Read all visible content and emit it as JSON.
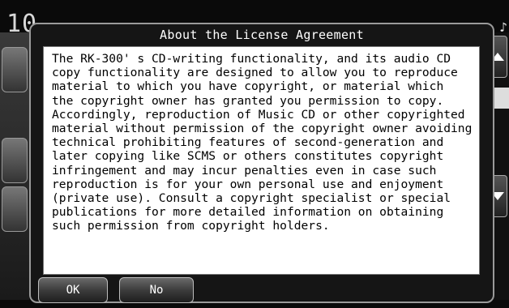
{
  "background": {
    "status_text": "10"
  },
  "dialog": {
    "title": "About the License Agreement",
    "message_lines": [
      "The RK-300' s CD-writing functionality, and its audio CD",
      "copy functionality are designed to allow you to reproduce",
      "material to which you have copyright, or material which",
      "the copyright owner has granted you permission to copy.",
      "Accordingly, reproduction of Music CD or other copyrighted",
      "material without permission of the copyright owner avoiding",
      "technical prohibiting features of second-generation and",
      "later copying like SCMS or others constitutes copyright",
      "infringement and may incur penalties even in case such",
      "reproduction is for your own personal use and enjoyment",
      "(private use). Consult a copyright specialist or special",
      "publications for more detailed information on obtaining",
      "such permission from copyright holders."
    ],
    "buttons": {
      "ok_label": "OK",
      "no_label": "No"
    }
  },
  "colors": {
    "dialog_bg": "#151515",
    "panel_bg": "#ffffff",
    "text_dark": "#000000",
    "text_light": "#ffffff"
  },
  "icons": {
    "scroll_up": "triangle-up-icon",
    "scroll_down": "triangle-down-icon",
    "music_note": "music-note-icon"
  }
}
